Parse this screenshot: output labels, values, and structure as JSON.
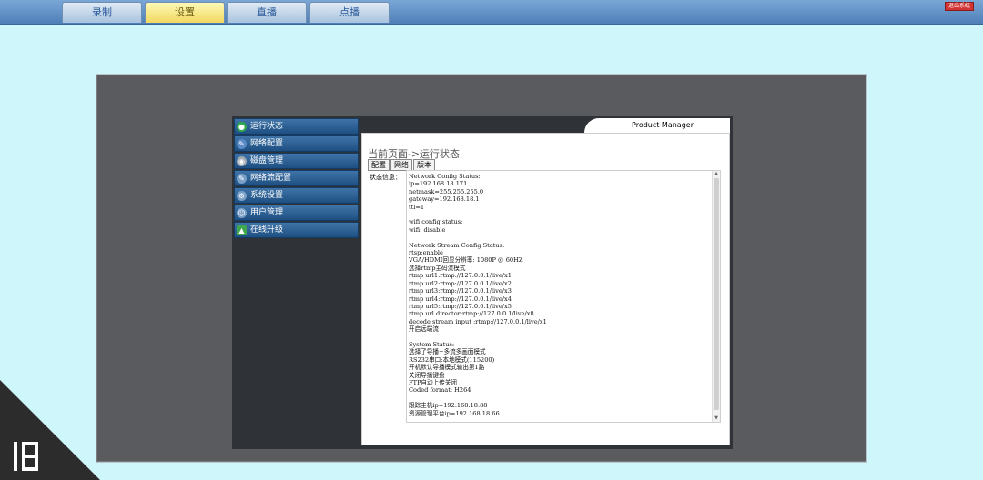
{
  "topbar": {
    "tabs": [
      {
        "label": "录制"
      },
      {
        "label": "设置"
      },
      {
        "label": "直播"
      },
      {
        "label": "点播"
      }
    ],
    "close_label": "退出系统"
  },
  "sidebar": {
    "items": [
      {
        "label": "运行状态"
      },
      {
        "label": "网络配置"
      },
      {
        "label": "磁盘管理"
      },
      {
        "label": "网络流配置"
      },
      {
        "label": "系统设置"
      },
      {
        "label": "用户管理"
      },
      {
        "label": "在线升级"
      }
    ]
  },
  "panel": {
    "product_label": "Product Manager",
    "breadcrumb": "当前页面->运行状态",
    "buttons": [
      "配置",
      "网络",
      "版本"
    ],
    "status_label": "状态信息：",
    "status_text": "Network Config Status:\nip=192.168.18.171\nnetmask=255.255.255.0\ngateway=192.168.18.1\nttl=1\n\nwifi config status:\nwifi: disable\n\nNetwork Stream Config Status:\nrtsp:enable\nVGA/HDMI回显分辨率: 1080P @ 60HZ\n选择rtmp主码流模式\nrtmp url1:rtmp://127.0.0.1/live/x1\nrtmp url2:rtmp://127.0.0.1/live/x2\nrtmp url3:rtmp://127.0.0.1/live/x3\nrtmp url4:rtmp://127.0.0.1/live/x4\nrtmp url5:rtmp://127.0.0.1/live/x5\nrtmp url director:rtmp://127.0.0.1/live/x8\ndecode stream input :rtmp://127.0.0.1/live/x1\n开启远端流\n\nSystem Status:\n选择了导播+多流多画面模式\nRS232串口:本地模式(115200)\n开机默认导播模式输出第1路\n关闭导播键盘\nFTP自动上传关闭\nCoded format: H264\n\n跟踪主机ip=192.168.18.88\n资源管理平台ip=192.168.18.66"
  },
  "colors": {
    "page_bg": "#cff7fb",
    "topbar": "#4f7fb8",
    "active_tab": "#f0d860",
    "sidebar": "#1e4f82"
  }
}
